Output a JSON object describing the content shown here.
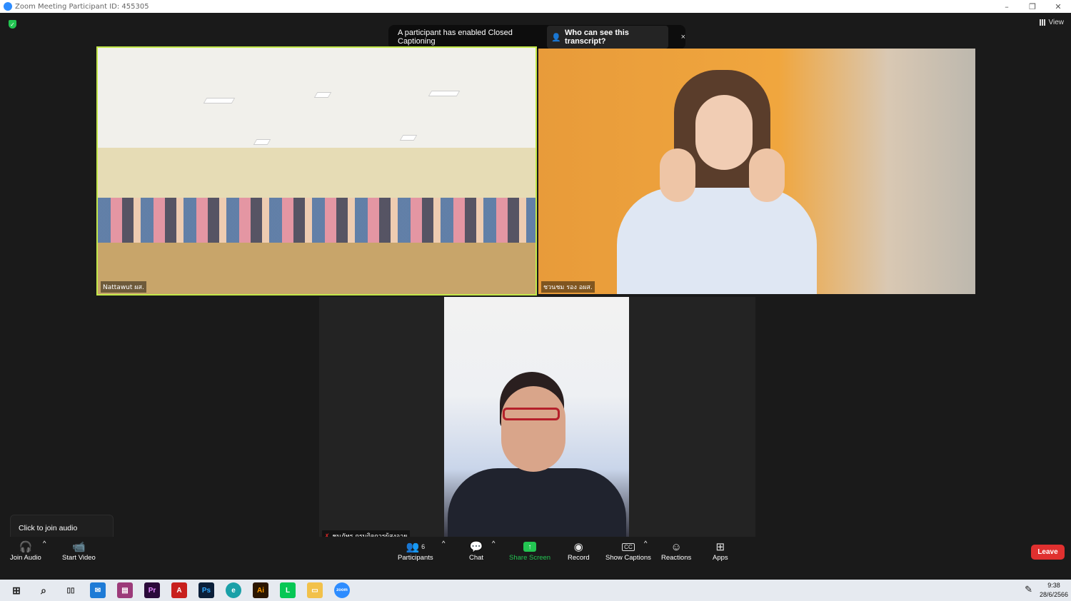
{
  "window": {
    "title": "Zoom Meeting Participant ID: 455305",
    "minimize": "–",
    "restore": "❐",
    "close": "✕"
  },
  "view_button": "View",
  "caption_banner": {
    "message": "A participant has enabled Closed Captioning",
    "who_button": "Who can see this transcript?",
    "close": "×"
  },
  "participants_tiles": [
    {
      "name": "Nattawut ผส."
    },
    {
      "name": "ชวนชม  รอง อผส."
    },
    {
      "name": "ชนภัทร  กรมกิจการผู้สูงอายุ"
    }
  ],
  "tooltip": "Click to join audio",
  "toolbar": {
    "join_audio": "Join Audio",
    "start_video": "Start Video",
    "participants": "Participants",
    "participants_count": "6",
    "chat": "Chat",
    "share_screen": "Share Screen",
    "record": "Record",
    "show_captions": "Show Captions",
    "reactions": "Reactions",
    "apps": "Apps",
    "leave": "Leave"
  },
  "taskbar": {
    "time": "9:38",
    "date": "28/6/2566",
    "icons": [
      "windows-start",
      "search",
      "task-view",
      "mail",
      "winrar",
      "premiere",
      "acrobat",
      "photoshop",
      "edge",
      "illustrator",
      "line",
      "file-explorer",
      "zoom"
    ]
  },
  "colors": {
    "active_speaker_border": "#c3e84a",
    "leave": "#e0302f",
    "share_green": "#23c552"
  }
}
